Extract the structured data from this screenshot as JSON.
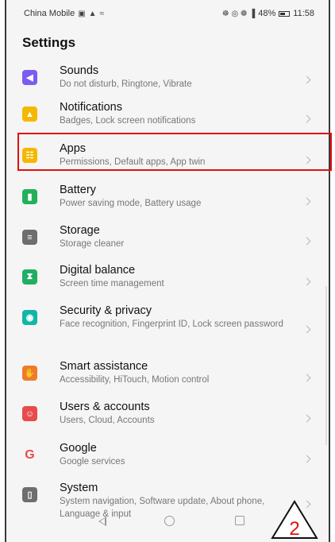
{
  "status": {
    "carrier": "China Mobile",
    "right_icons": "☸ ◎ ❁ ▐",
    "battery": "48%",
    "time": "11:58"
  },
  "header": {
    "title": "Settings"
  },
  "items": [
    {
      "title": "Sounds",
      "subtitle": "Do not disturb, Ringtone, Vibrate",
      "icon": "speaker-icon",
      "color": "#7b5cf0",
      "glyph": "◀"
    },
    {
      "title": "Notifications",
      "subtitle": "Badges, Lock screen notifications",
      "icon": "bell-icon",
      "color": "#f5b800",
      "glyph": "▲"
    },
    {
      "title": "Apps",
      "subtitle": "Permissions, Default apps, App twin",
      "icon": "apps-grid-icon",
      "color": "#f5b800",
      "glyph": "☷"
    },
    {
      "title": "Battery",
      "subtitle": "Power saving mode, Battery usage",
      "icon": "battery-icon",
      "color": "#23b05a",
      "glyph": "▮"
    },
    {
      "title": "Storage",
      "subtitle": "Storage cleaner",
      "icon": "storage-icon",
      "color": "#6e6e6e",
      "glyph": "≡"
    },
    {
      "title": "Digital balance",
      "subtitle": "Screen time management",
      "icon": "hourglass-icon",
      "color": "#1fae62",
      "glyph": "⧗"
    },
    {
      "title": "Security & privacy",
      "subtitle": "Face recognition, Fingerprint ID, Lock screen password",
      "icon": "shield-icon",
      "color": "#12b6a6",
      "glyph": "◉"
    },
    {
      "title": "Smart assistance",
      "subtitle": "Accessibility, HiTouch, Motion control",
      "icon": "hand-icon",
      "color": "#f07b2a",
      "glyph": "✋"
    },
    {
      "title": "Users & accounts",
      "subtitle": "Users, Cloud, Accounts",
      "icon": "user-icon",
      "color": "#e84b4b",
      "glyph": "☺"
    },
    {
      "title": "Google",
      "subtitle": "Google services",
      "icon": "google-icon",
      "color": "#ffffff",
      "glyph": "G"
    },
    {
      "title": "System",
      "subtitle": "System navigation, Software update, About phone, Language & input",
      "icon": "phone-icon",
      "color": "#6e6e6e",
      "glyph": "▯"
    }
  ],
  "annotation": {
    "marker_number": "2",
    "highlight_color": "#e01010"
  }
}
